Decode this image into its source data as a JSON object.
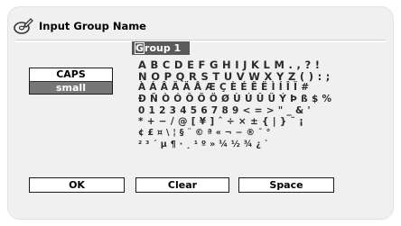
{
  "header": {
    "title": "Input Group Name",
    "icon": "disc-pencil-icon"
  },
  "group_field": {
    "cursor_char": "G",
    "rest": "roup 1"
  },
  "mode": {
    "caps_label": "CAPS",
    "small_label": "small",
    "selected": "small"
  },
  "charset": {
    "rows": [
      "A B C D E F G H I J K L M . , ? !",
      "N O P Q R S T U V W X Y Z ( ) : ;",
      "À Á Â Ã Ä Å Æ Ç È É Ê Ë Ì Í Î Ï #",
      "Ð Ñ Ò Ó Ô Õ Ö Ø Ù Ú Û Ü Ý Þ ß $ %",
      "0 1 2 3 4 5 6 7 8 9 < = > \" _ & '",
      "* + − / @ [ ¥ ] ˆ ÷ × ± { | } ˜ ¡",
      "¢ £ ¤ \\ ¦ § ¨ © ª « ¬ − ® ¯ °",
      "² ³ ´ µ ¶ · ¸ ¹ º » ¼ ½ ¾ ¿ `"
    ]
  },
  "buttons": {
    "ok": "OK",
    "clear": "Clear",
    "space": "Space"
  }
}
